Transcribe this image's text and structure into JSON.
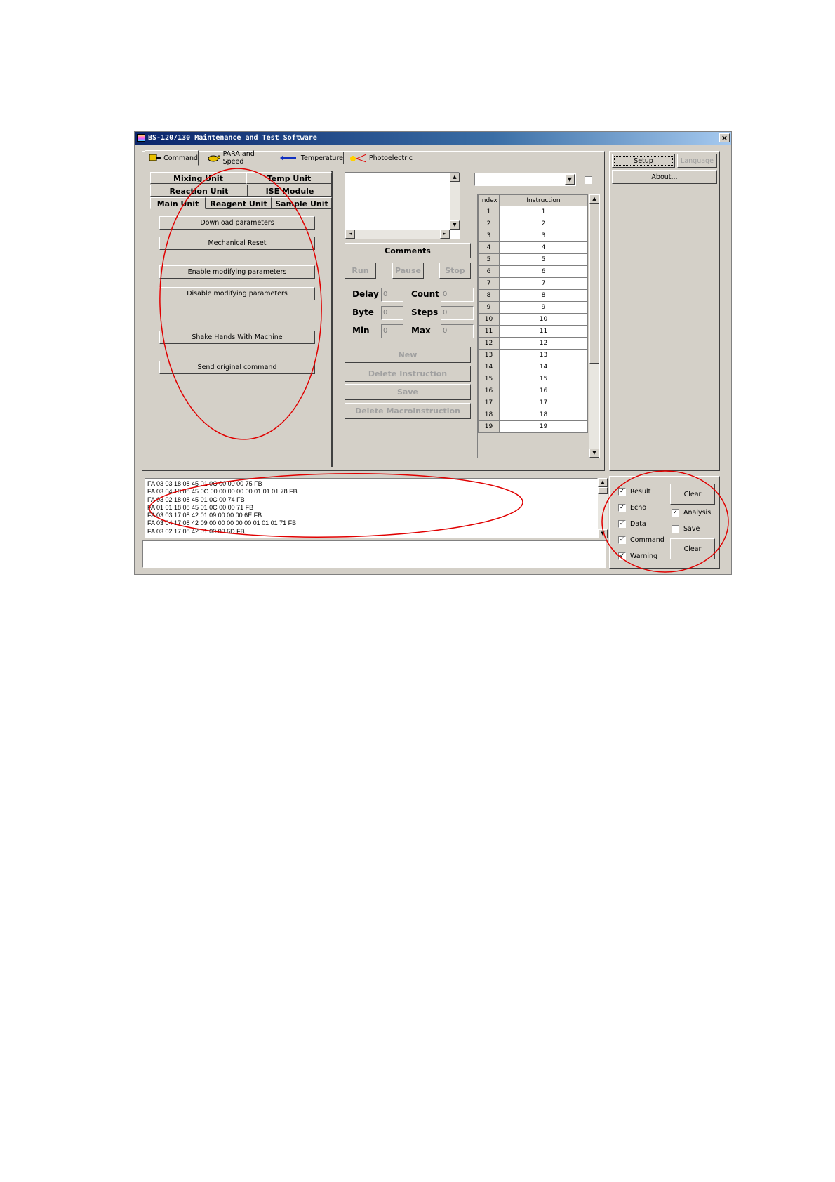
{
  "window": {
    "title": "BS-120/130 Maintenance and Test Software",
    "close_glyph": "×"
  },
  "main_tabs": [
    {
      "label": "Command",
      "icon": "robot-icon"
    },
    {
      "label": "PARA and Speed",
      "icon": "turtle-icon"
    },
    {
      "label": "Temperature",
      "icon": "thermometer-icon"
    },
    {
      "label": "Photoelectric",
      "icon": "light-beam-icon"
    }
  ],
  "unit_tabs": {
    "row1": [
      "Mixing Unit",
      "Temp Unit"
    ],
    "row2": [
      "Reaction Unit",
      "ISE Module"
    ],
    "row3": [
      "Main Unit",
      "Reagent Unit",
      "Sample Unit"
    ]
  },
  "unit_buttons": {
    "download": "Download parameters",
    "reset": "Mechanical Reset",
    "enable": "Enable modifying parameters",
    "disable": "Disable modifying parameters",
    "shake": "Shake Hands With Machine",
    "send": "Send original command"
  },
  "editor": {
    "comments": "Comments",
    "run": "Run",
    "pause": "Pause",
    "stop": "Stop",
    "delay_label": "Delay",
    "delay_value": "0",
    "count_label": "Count",
    "count_value": "0",
    "byte_label": "Byte",
    "byte_value": "0",
    "steps_label": "Steps",
    "steps_value": "0",
    "min_label": "Min",
    "min_value": "0",
    "max_label": "Max",
    "max_value": "0",
    "new": "New",
    "delete_instruction": "Delete Instruction",
    "save": "Save",
    "delete_macro": "Delete Macroinstruction"
  },
  "instruction_table": {
    "headers": [
      "Index",
      "Instruction"
    ],
    "rows": [
      [
        "1",
        "1"
      ],
      [
        "2",
        "2"
      ],
      [
        "3",
        "3"
      ],
      [
        "4",
        "4"
      ],
      [
        "5",
        "5"
      ],
      [
        "6",
        "6"
      ],
      [
        "7",
        "7"
      ],
      [
        "8",
        "8"
      ],
      [
        "9",
        "9"
      ],
      [
        "10",
        "10"
      ],
      [
        "11",
        "11"
      ],
      [
        "12",
        "12"
      ],
      [
        "13",
        "13"
      ],
      [
        "14",
        "14"
      ],
      [
        "15",
        "15"
      ],
      [
        "16",
        "16"
      ],
      [
        "17",
        "17"
      ],
      [
        "18",
        "18"
      ],
      [
        "19",
        "19"
      ]
    ]
  },
  "right_panel": {
    "setup": "Setup",
    "language": "Language",
    "about": "About..."
  },
  "log_lines": [
    "FA 03 03 18 08 45 01 0C 00 00 00 75 FB",
    "FA 03 04 18 08 45 0C 00 00 00 00 00 01 01 01 78 FB",
    "FA 03 02 18 08 45 01 0C 00 74 FB",
    "FA 01 01 18 08 45 01 0C 00 00 71 FB",
    "FA 03 03 17 08 42 01 09 00 00 00 6E FB",
    "FA 03 04 17 08 42 09 00 00 00 00 00 01 01 01 71 FB",
    "FA 03 02 17 08 42 01 09 00 6D FB"
  ],
  "filters": {
    "result": "Result",
    "echo": "Echo",
    "data": "Data",
    "command": "Command",
    "warning": "Warning",
    "analysis": "Analysis",
    "save": "Save",
    "clear1": "Clear",
    "clear2": "Clear",
    "checked_mark": "✓"
  },
  "annotation_color": "#e00000"
}
